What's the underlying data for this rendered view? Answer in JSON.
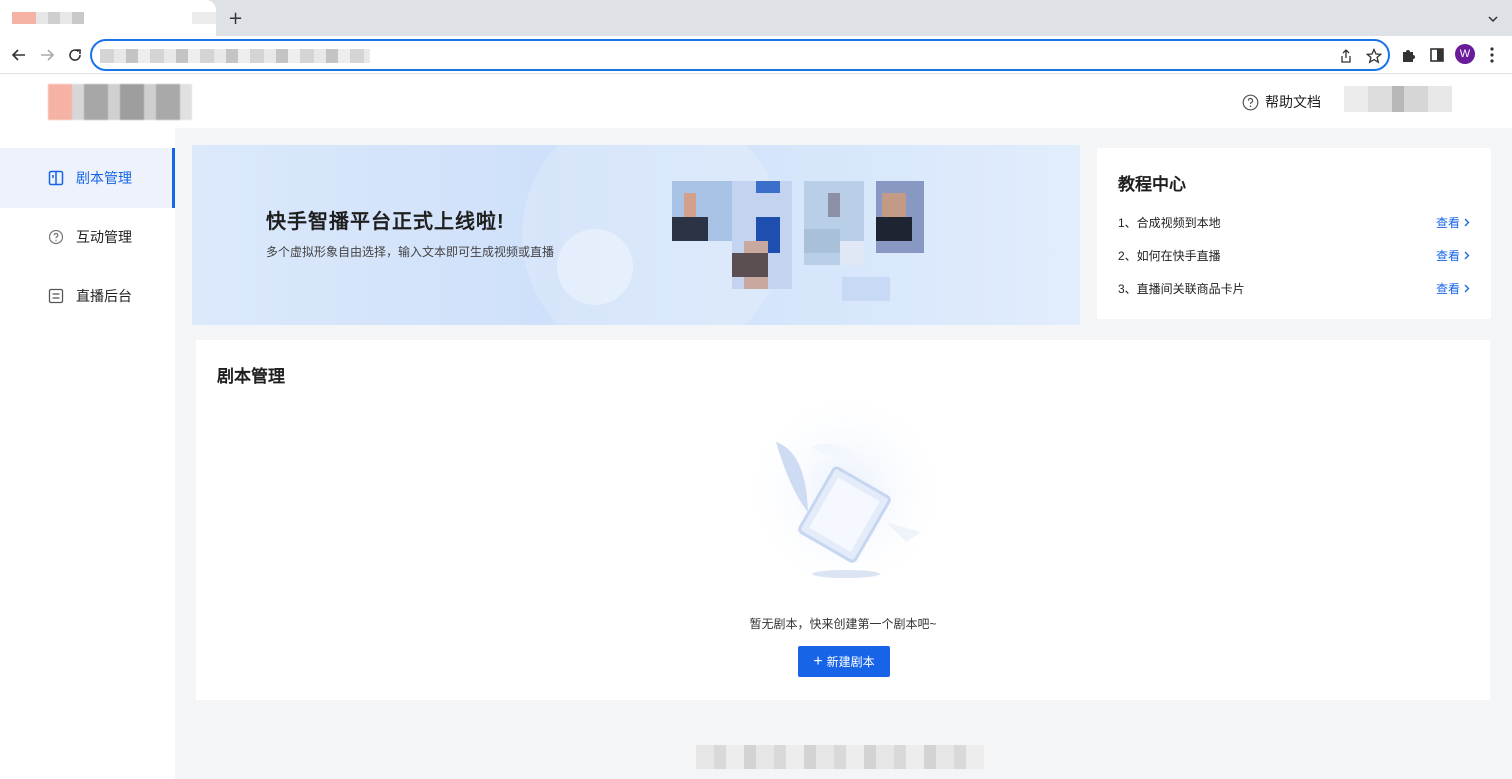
{
  "browser": {
    "new_tab_label": "+",
    "profile_initial": "W"
  },
  "header": {
    "help_label": "帮助文档"
  },
  "sidebar": {
    "items": [
      {
        "label": "剧本管理",
        "icon": "book-icon",
        "active": true
      },
      {
        "label": "互动管理",
        "icon": "question-circle-icon",
        "active": false
      },
      {
        "label": "直播后台",
        "icon": "list-box-icon",
        "active": false
      }
    ]
  },
  "banner": {
    "title": "快手智播平台正式上线啦!",
    "subtitle": "多个虚拟形象自由选择，输入文本即可生成视频或直播"
  },
  "tutorial": {
    "title": "教程中心",
    "items": [
      {
        "text": "1、合成视频到本地",
        "link": "查看"
      },
      {
        "text": "2、如何在快手直播",
        "link": "查看"
      },
      {
        "text": "3、直播间关联商品卡片",
        "link": "查看"
      }
    ]
  },
  "scripts": {
    "title": "剧本管理",
    "empty_text": "暂无剧本，快来创建第一个剧本吧~",
    "new_button_label": "新建剧本",
    "new_button_icon": "+"
  },
  "colors": {
    "accent": "#1764e8",
    "active_bg": "#eef3fb",
    "content_bg": "#f4f5f7"
  }
}
